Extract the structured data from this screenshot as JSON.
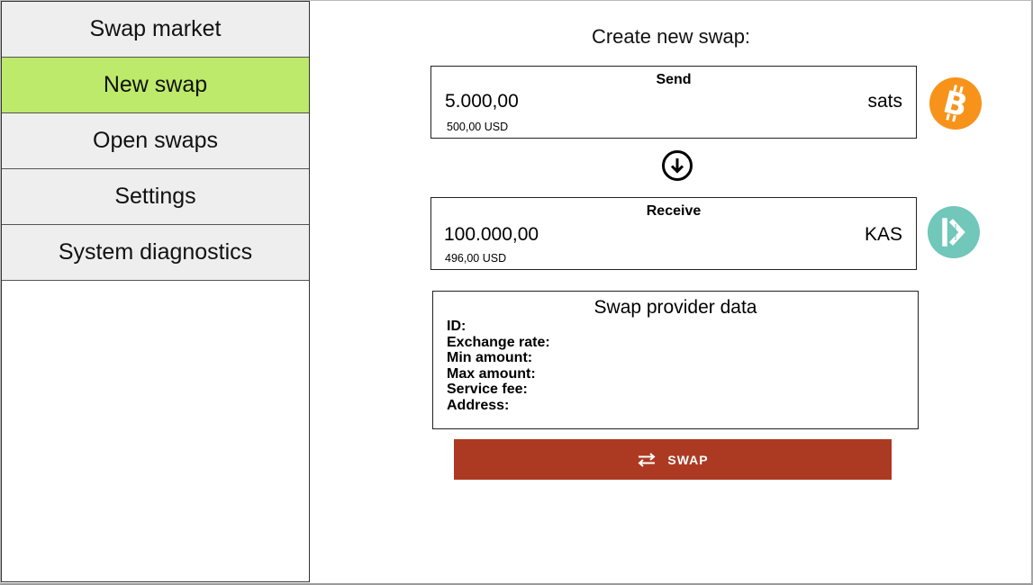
{
  "sidebar": {
    "items": [
      {
        "label": "Swap market",
        "active": false
      },
      {
        "label": "New swap",
        "active": true
      },
      {
        "label": "Open swaps",
        "active": false
      },
      {
        "label": "Settings",
        "active": false
      },
      {
        "label": "System diagnostics",
        "active": false
      }
    ],
    "active_color": "#bdea6a",
    "item_color": "#eeeeee"
  },
  "main": {
    "title": "Create new swap:",
    "send": {
      "label": "Send",
      "amount": "5.000,00",
      "unit": "sats",
      "fiat": "500,00 USD",
      "icon": "bitcoin-icon",
      "icon_color": "#f7931a"
    },
    "switch_icon": "arrow-down-circle-icon",
    "receive": {
      "label": "Receive",
      "amount": "100.000,00",
      "unit": "KAS",
      "fiat": "496,00 USD",
      "icon": "kaspa-icon",
      "icon_color": "#70c7ba"
    },
    "provider": {
      "title": "Swap provider data",
      "fields": {
        "id": "ID:",
        "exchange_rate": "Exchange rate:",
        "min_amount": "Min amount:",
        "max_amount": "Max amount:",
        "service_fee": "Service fee:",
        "address": "Address:"
      }
    },
    "swap_button": {
      "label": "SWAP",
      "icon": "swap-arrows-icon",
      "color": "#ac3a22"
    }
  }
}
